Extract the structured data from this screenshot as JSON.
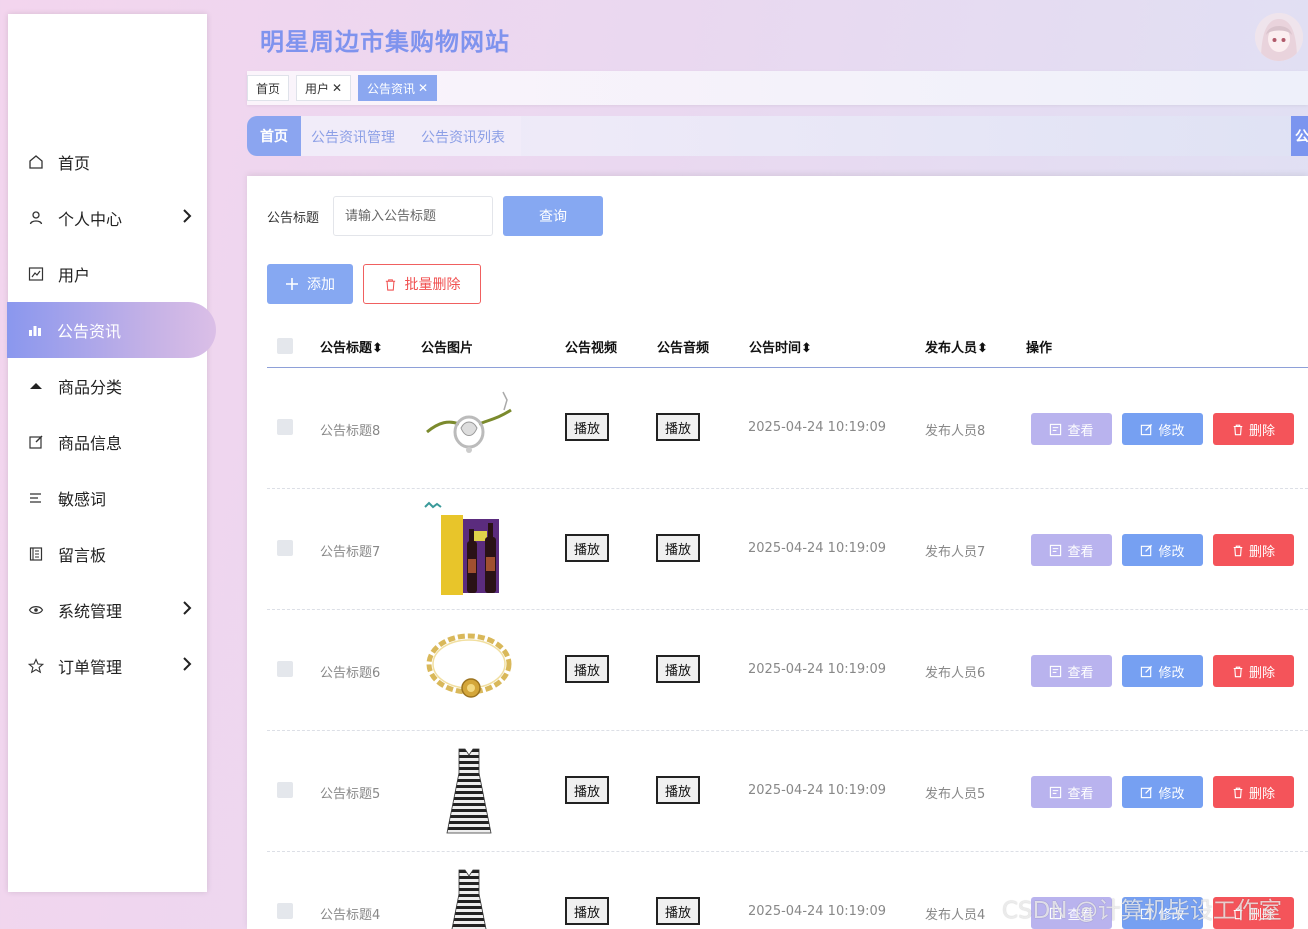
{
  "site": {
    "title": "明星周边市集购物网站"
  },
  "menu": [
    {
      "label": "首页",
      "icon": "home-icon",
      "arrow": false
    },
    {
      "label": "个人中心",
      "icon": "user-icon",
      "arrow": true
    },
    {
      "label": "用户",
      "icon": "chart-box-icon",
      "arrow": false
    },
    {
      "label": "公告资讯",
      "icon": "bar-chart-icon",
      "arrow": false,
      "active": true
    },
    {
      "label": "商品分类",
      "icon": "caret-up-icon",
      "arrow": false
    },
    {
      "label": "商品信息",
      "icon": "edit-icon",
      "arrow": false
    },
    {
      "label": "敏感词",
      "icon": "list-icon",
      "arrow": false
    },
    {
      "label": "留言板",
      "icon": "notebook-icon",
      "arrow": false
    },
    {
      "label": "系统管理",
      "icon": "eye-icon",
      "arrow": true
    },
    {
      "label": "订单管理",
      "icon": "star-icon",
      "arrow": true
    }
  ],
  "tags": [
    {
      "label": "首页",
      "closable": false
    },
    {
      "label": "用户",
      "closable": true
    },
    {
      "label": "公告资讯",
      "closable": true,
      "active": true
    }
  ],
  "tag_close_glyph": "✕",
  "breadcrumb": {
    "home": "首页",
    "items": [
      "公告资讯管理",
      "公告资讯列表"
    ],
    "end_text": "公"
  },
  "search": {
    "label": "公告标题",
    "placeholder": "请输入公告标题",
    "button": "查询"
  },
  "toolbar": {
    "add": "添加",
    "batch_delete": "批量删除"
  },
  "table": {
    "columns": [
      "公告标题",
      "公告图片",
      "公告视频",
      "公告音频",
      "公告时间",
      "发布人员",
      "操作"
    ],
    "sortable": [
      true,
      false,
      false,
      false,
      true,
      true,
      false
    ],
    "sort_glyph": "⬍",
    "play_label": "播放",
    "actions": {
      "view": "查看",
      "edit": "修改",
      "delete": "删除"
    },
    "rows": [
      {
        "title": "公告标题8",
        "image": "bracelet-silver",
        "time": "2025-04-24 10:19:09",
        "publisher": "发布人员8"
      },
      {
        "title": "公告标题7",
        "image": "wine-box",
        "time": "2025-04-24 10:19:09",
        "publisher": "发布人员7"
      },
      {
        "title": "公告标题6",
        "image": "bracelet-gold",
        "time": "2025-04-24 10:19:09",
        "publisher": "发布人员6"
      },
      {
        "title": "公告标题5",
        "image": "striped-dress",
        "time": "2025-04-24 10:19:09",
        "publisher": "发布人员5"
      },
      {
        "title": "公告标题4",
        "image": "striped-dress",
        "time": "2025-04-24 10:19:09",
        "publisher": "发布人员4"
      }
    ]
  },
  "watermark": "CSDN @计算机毕设工作室",
  "colors": {
    "accent": "#86a8f2",
    "title": "#7f93ee",
    "view": "#b9b3ee",
    "edit": "#76a0f2",
    "delete": "#f4545a"
  }
}
